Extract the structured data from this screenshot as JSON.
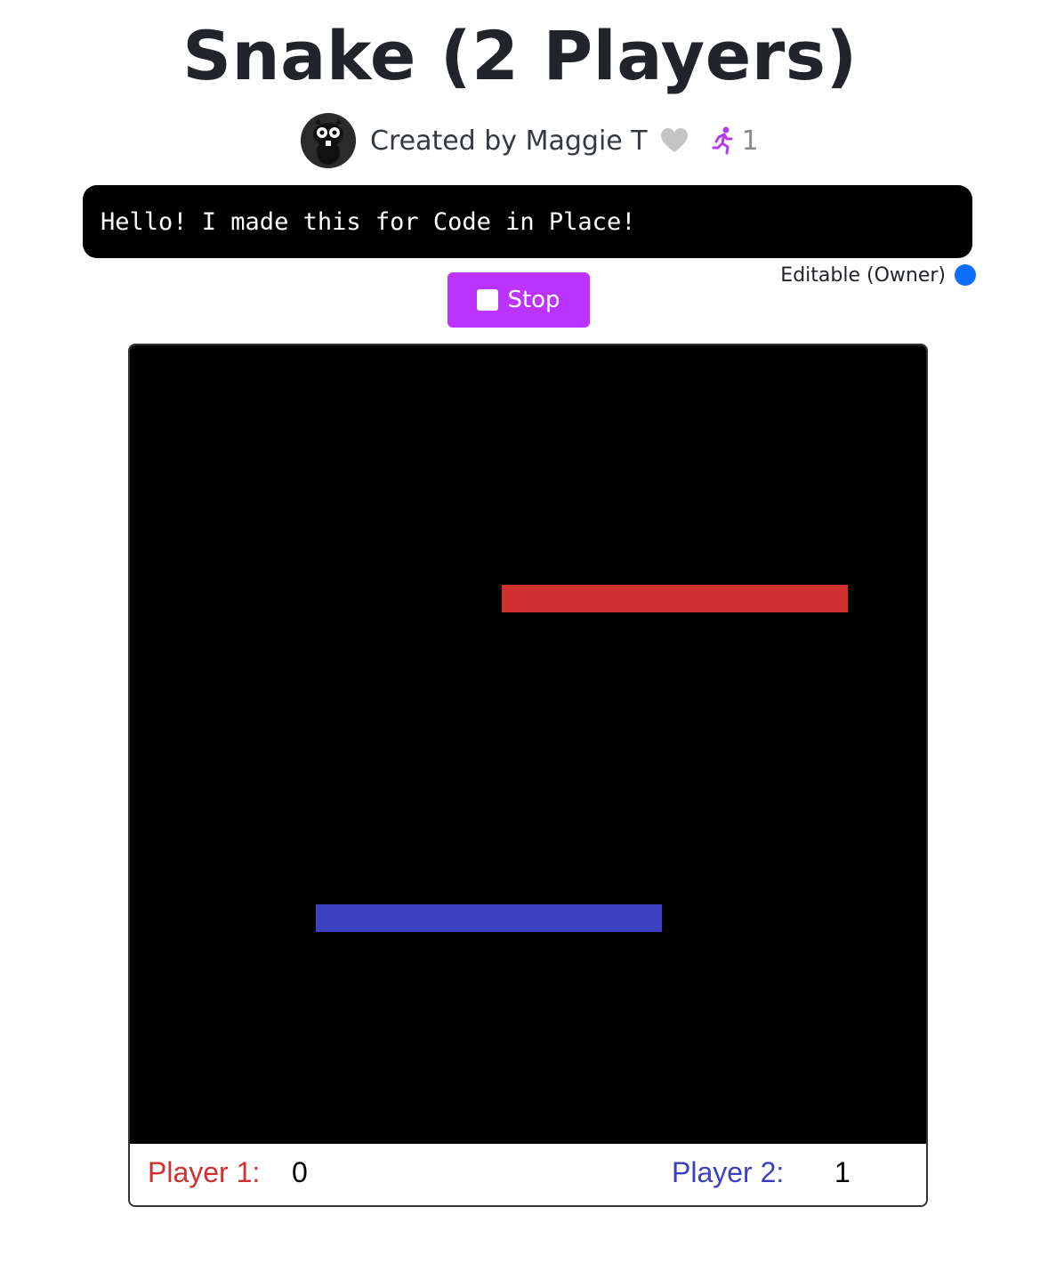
{
  "page": {
    "title": "Snake (2 Players)",
    "creator_text": "Created by Maggie T",
    "run_count": "1",
    "message": "Hello! I made this for Code in Place!",
    "editable_text": "Editable (Owner)",
    "stop_label": "Stop"
  },
  "icons": {
    "avatar": "avatar-icon",
    "heart": "heart-icon",
    "runner": "runner-icon",
    "stop": "stop-icon",
    "status_dot": "status-dot"
  },
  "colors": {
    "accent": "#bb33ff",
    "status_dot": "#0d6efd",
    "player1": "#d03030",
    "player2": "#3a40bf",
    "board": "#000000"
  },
  "game": {
    "player1": {
      "label": "Player 1:",
      "score": "0"
    },
    "player2": {
      "label": "Player 2:",
      "score": "1"
    }
  }
}
